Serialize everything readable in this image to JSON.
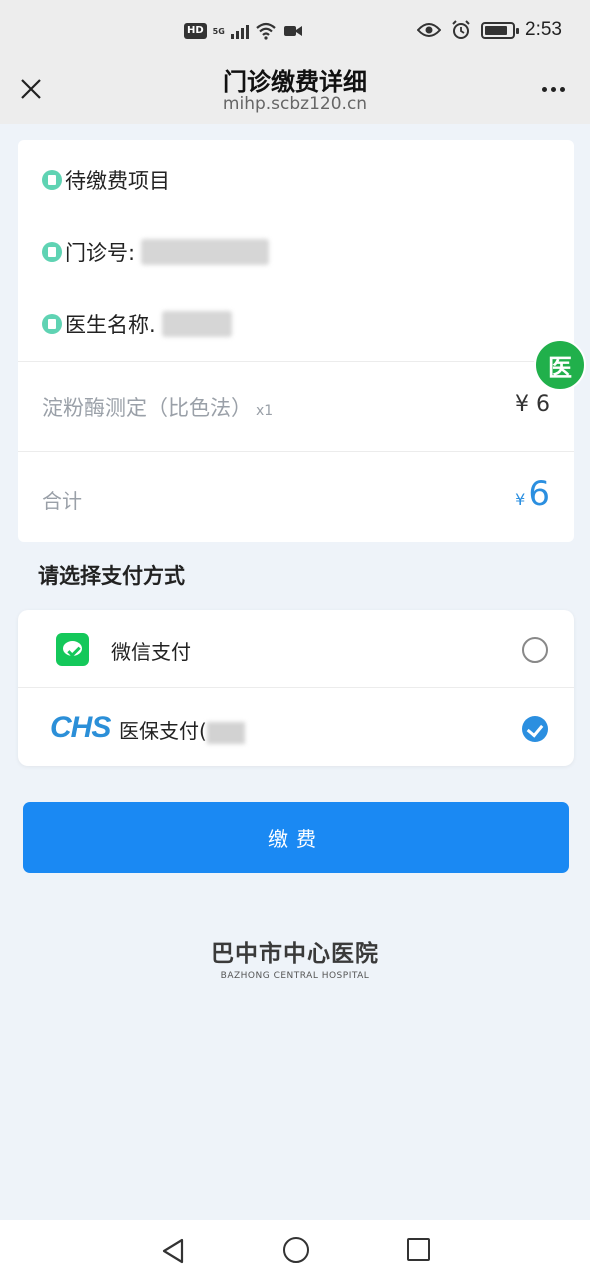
{
  "status_bar": {
    "hd": "HD",
    "network": "5G",
    "time": "2:53",
    "icons": [
      "hd-icon",
      "signal-icon",
      "wifi-icon",
      "camera-icon",
      "eye-icon",
      "alarm-icon",
      "battery-icon"
    ]
  },
  "header": {
    "title": "门诊缴费详细",
    "url": "mihp.scbz120.cn",
    "close_icon": "close-icon",
    "more_icon": "more-icon"
  },
  "details": {
    "pending_title": "待缴费项目",
    "clinic_no_label": "门诊号:",
    "doctor_label": "医生名称.",
    "item": {
      "name": "淀粉酶测定（比色法）",
      "qty": "x1",
      "price": "¥ 6"
    },
    "total": {
      "label": "合计",
      "currency": "¥",
      "amount": "6"
    }
  },
  "float_badge": {
    "label": "医"
  },
  "payment": {
    "section_title": "请选择支付方式",
    "options": [
      {
        "label": "微信支付",
        "icon": "wechat-icon",
        "selected": false
      },
      {
        "label": "医保支付(",
        "icon": "chs-logo",
        "logo_text": "CHS",
        "selected": true
      }
    ]
  },
  "pay_button": {
    "label": "缴费"
  },
  "footer": {
    "hospital_cn": "巴中市中心医院",
    "hospital_en": "BAZHONG CENTRAL HOSPITAL"
  },
  "colors": {
    "accent": "#1a89f3",
    "total_amount": "#2b8fe0",
    "wechat_green": "#14c85a",
    "badge_green": "#21b04b",
    "dot_teal": "#5fd3b3"
  }
}
